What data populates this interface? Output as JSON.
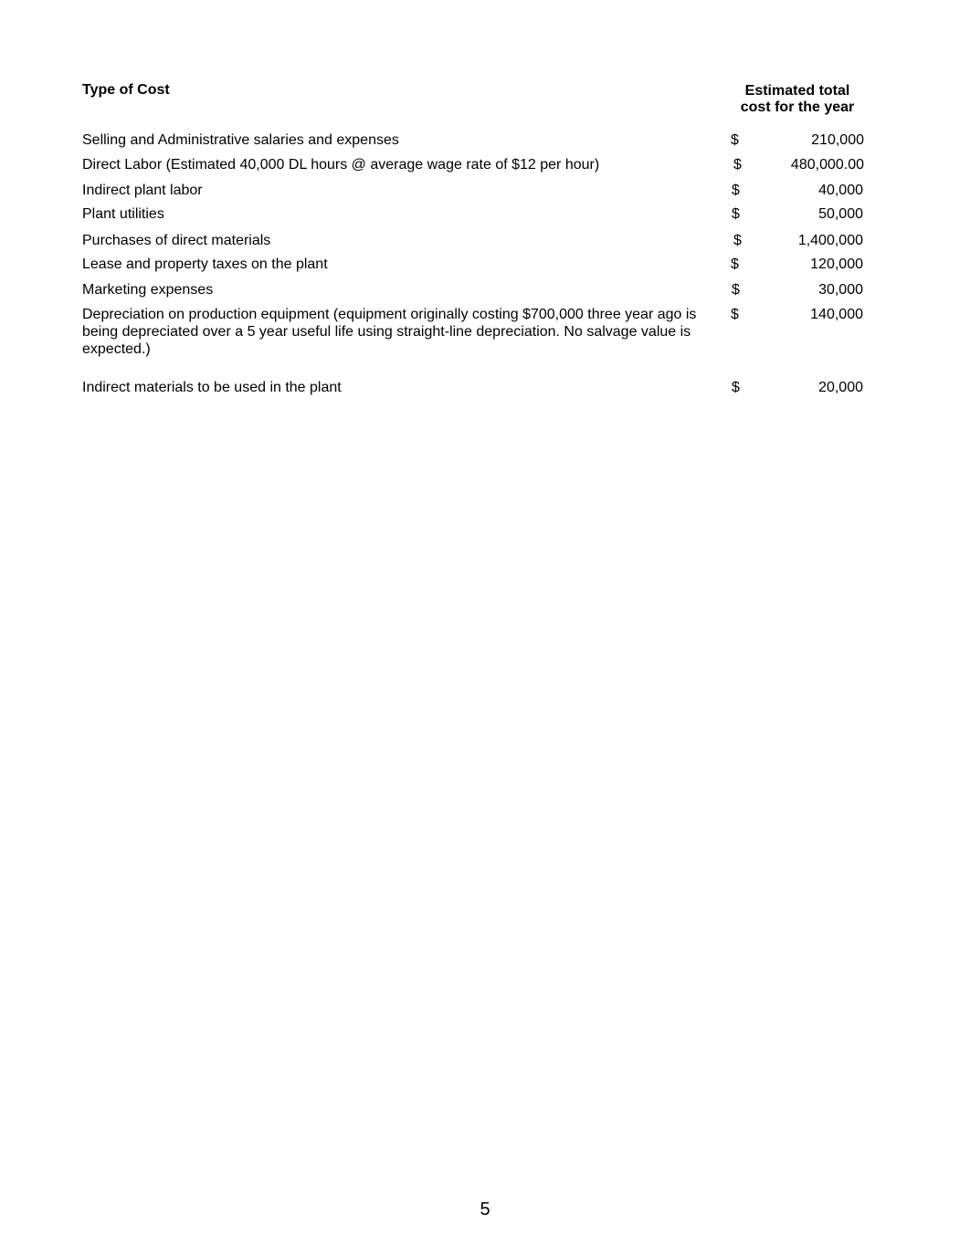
{
  "header": {
    "type_of_cost": "Type of Cost",
    "estimated_line1": "Estimated total",
    "estimated_line2": "cost for the year"
  },
  "rows": [
    {
      "description": "Selling and Administrative salaries and expenses",
      "currency": "$",
      "amount": "210,000"
    },
    {
      "description": "Direct Labor (Estimated 40,000 DL hours @ average wage rate of $12 per hour)",
      "currency": "$",
      "amount": "480,000.00"
    },
    {
      "description": "Indirect plant labor",
      "currency": "$",
      "amount": "40,000"
    },
    {
      "description": "Plant utilities",
      "currency": "$",
      "amount": "50,000"
    },
    {
      "description": "Purchases of direct materials",
      "currency": "$",
      "amount": "1,400,000"
    },
    {
      "description": "Lease and property taxes on the plant",
      "currency": "$",
      "amount": "120,000"
    },
    {
      "description": "Marketing expenses",
      "currency": "$",
      "amount": "30,000"
    },
    {
      "description": "Depreciation on production equipment (equipment originally costing $700,000 three year ago is being depreciated over a 5 year useful life using straight-line depreciation.  No salvage value is expected.)",
      "currency": "$",
      "amount": "140,000"
    },
    {
      "description": "Indirect materials to be used in the plant",
      "currency": "$",
      "amount": "20,000"
    }
  ],
  "footer": {
    "page_number": "5"
  }
}
